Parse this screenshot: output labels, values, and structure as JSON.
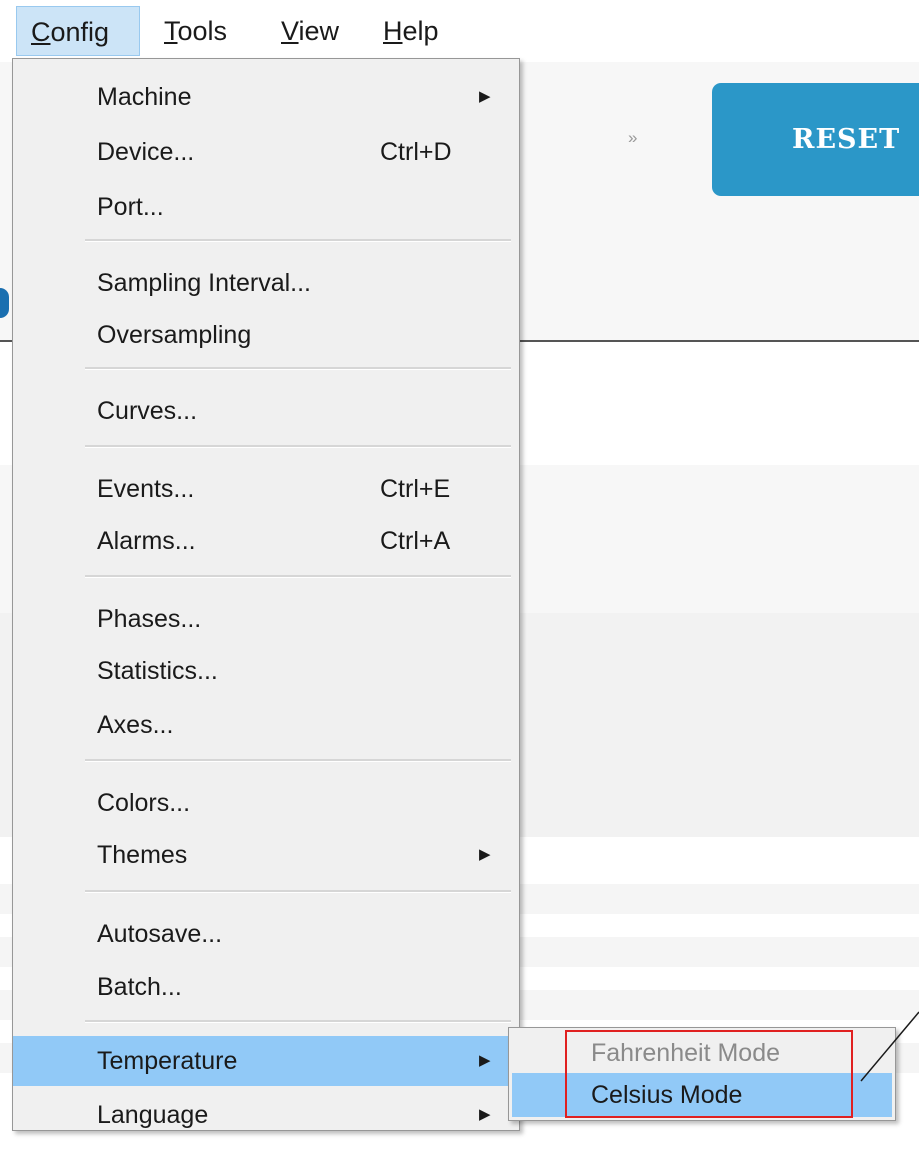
{
  "menubar": {
    "items": [
      {
        "label": "Config",
        "mnemonic": "C",
        "rest": "onfig",
        "active": true
      },
      {
        "label": "Tools",
        "mnemonic": "T",
        "rest": "ools",
        "active": false
      },
      {
        "label": "View",
        "mnemonic": "V",
        "rest": "iew",
        "active": false
      },
      {
        "label": "Help",
        "mnemonic": "H",
        "rest": "elp",
        "active": false
      }
    ]
  },
  "background": {
    "reset_label": "RESET",
    "chevron": "»",
    "accent_color": "#2b97c8"
  },
  "config_menu": {
    "items": [
      {
        "label": "Machine",
        "shortcut": "",
        "submenu": true
      },
      {
        "label": "Device...",
        "shortcut": "Ctrl+D",
        "submenu": false
      },
      {
        "label": "Port...",
        "shortcut": "",
        "submenu": false
      },
      {
        "label": "Sampling Interval...",
        "shortcut": "",
        "submenu": false
      },
      {
        "label": "Oversampling",
        "shortcut": "",
        "submenu": false
      },
      {
        "label": "Curves...",
        "shortcut": "",
        "submenu": false
      },
      {
        "label": "Events...",
        "shortcut": "Ctrl+E",
        "submenu": false
      },
      {
        "label": "Alarms...",
        "shortcut": "Ctrl+A",
        "submenu": false
      },
      {
        "label": "Phases...",
        "shortcut": "",
        "submenu": false
      },
      {
        "label": "Statistics...",
        "shortcut": "",
        "submenu": false
      },
      {
        "label": "Axes...",
        "shortcut": "",
        "submenu": false
      },
      {
        "label": "Colors...",
        "shortcut": "",
        "submenu": false
      },
      {
        "label": "Themes",
        "shortcut": "",
        "submenu": true
      },
      {
        "label": "Autosave...",
        "shortcut": "",
        "submenu": false
      },
      {
        "label": "Batch...",
        "shortcut": "",
        "submenu": false
      },
      {
        "label": "Temperature",
        "shortcut": "",
        "submenu": true,
        "highlighted": true
      },
      {
        "label": "Language",
        "shortcut": "",
        "submenu": true
      }
    ],
    "highlight_color": "#91c9f7"
  },
  "temperature_submenu": {
    "items": [
      {
        "label": "Fahrenheit Mode",
        "enabled": false
      },
      {
        "label": "Celsius Mode",
        "enabled": true,
        "highlighted": true
      }
    ],
    "annotation_color": "#e02020"
  }
}
